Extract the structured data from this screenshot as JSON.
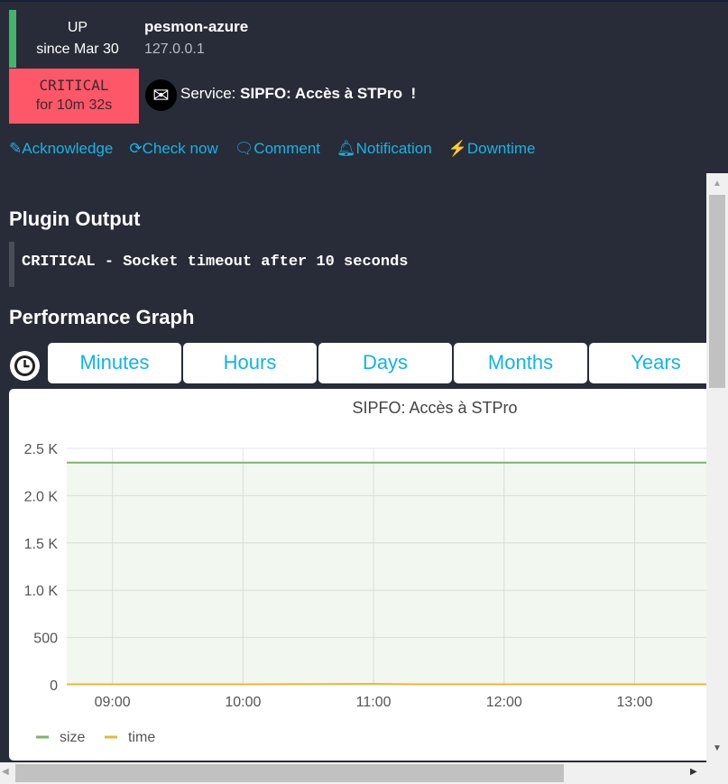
{
  "host": {
    "state": "UP",
    "since": "since Mar 30",
    "name": "pesmon-azure",
    "address": "127.0.0.1",
    "state_color": "#41b66b"
  },
  "service": {
    "state": "CRITICAL",
    "duration": "for 10m 32s",
    "label": "Service:",
    "name": "SIPFO: Accès à STPro",
    "flag": "!",
    "state_color": "#fd5768",
    "icon": "envelope-icon"
  },
  "actions": [
    {
      "label": "Acknowledge",
      "icon": "edit-icon"
    },
    {
      "label": "Check now",
      "icon": "refresh-icon"
    },
    {
      "label": "Comment",
      "icon": "comment-icon"
    },
    {
      "label": "Notification",
      "icon": "bell-icon"
    },
    {
      "label": "Downtime",
      "icon": "plug-icon"
    }
  ],
  "plugin_output": {
    "title": "Plugin Output",
    "text": "CRITICAL - Socket timeout after 10 seconds"
  },
  "perf": {
    "title": "Performance Graph",
    "tabs": [
      "Minutes",
      "Hours",
      "Days",
      "Months",
      "Years"
    ]
  },
  "chart_data": {
    "type": "line",
    "title": "SIPFO: Accès à STPro",
    "x_ticks": [
      "09:00",
      "10:00",
      "11:00",
      "12:00",
      "13:00"
    ],
    "y_ticks": [
      "0",
      "500",
      "1.0 K",
      "1.5 K",
      "2.0 K",
      "2.5 K"
    ],
    "ylim": [
      0,
      2500
    ],
    "xlim": [
      "08:39",
      "13:40"
    ],
    "grid": true,
    "legend": "bottom-left",
    "series": [
      {
        "name": "size",
        "color": "#7eb26d",
        "fill": true,
        "x": [
          "08:39",
          "09:00",
          "10:00",
          "11:00",
          "12:00",
          "13:00",
          "13:40"
        ],
        "values": [
          2350,
          2350,
          2350,
          2350,
          2350,
          2350,
          2350
        ]
      },
      {
        "name": "time",
        "color": "#eab839",
        "fill": false,
        "x": [
          "08:39",
          "09:00",
          "10:00",
          "11:00",
          "11:20",
          "12:00",
          "13:00",
          "13:40"
        ],
        "values": [
          5,
          5,
          5,
          10,
          5,
          5,
          5,
          5
        ]
      }
    ]
  }
}
